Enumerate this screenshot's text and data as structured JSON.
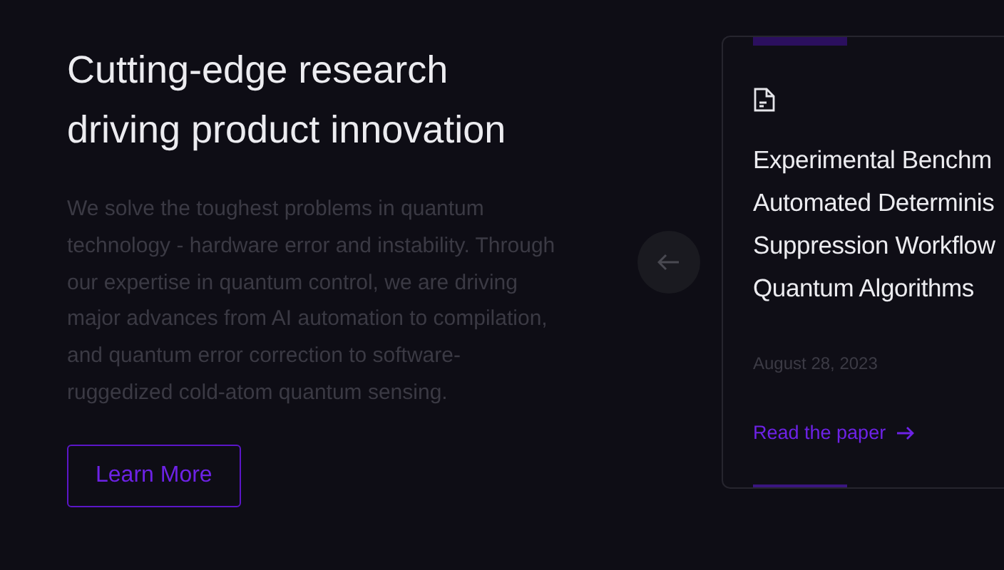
{
  "hero": {
    "heading_lines": [
      "Cutting-edge research",
      "driving product innovation"
    ],
    "description": "We solve the toughest problems in quantum technology - hardware error and instability. Through our expertise in quantum control, we are driving major advances from AI automation to compilation, and quantum error correction to software-ruggedized cold-atom quantum sensing.",
    "button": "Learn More"
  },
  "carousel": {
    "prev_disabled": true,
    "card": {
      "title_lines": [
        "Experimental Benchm",
        "Automated Determinis",
        "Suppression Workflow",
        "Quantum Algorithms"
      ],
      "date": "August 28, 2023",
      "link": "Read the paper"
    }
  }
}
